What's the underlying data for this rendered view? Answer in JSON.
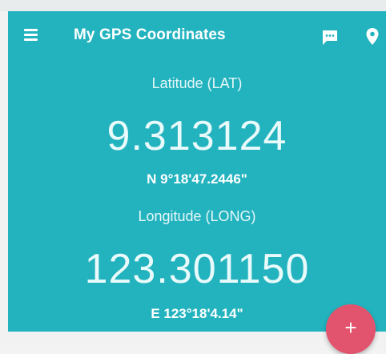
{
  "header": {
    "title": "My GPS Coordinates",
    "menu_icon": "hamburger-menu-icon",
    "message_icon": "message-icon",
    "location_icon": "location-pin-icon"
  },
  "latitude": {
    "label": "Latitude (LAT)",
    "decimal": "9.313124",
    "dms": "N 9°18'47.2446\""
  },
  "longitude": {
    "label": "Longitude (LONG)",
    "decimal": "123.301150",
    "dms": "E 123°18'4.14\""
  },
  "fab": {
    "symbol": "+",
    "icon": "add-icon"
  },
  "colors": {
    "primary": "#23b3bf",
    "accent": "#e2546d",
    "text": "#ffffff"
  }
}
